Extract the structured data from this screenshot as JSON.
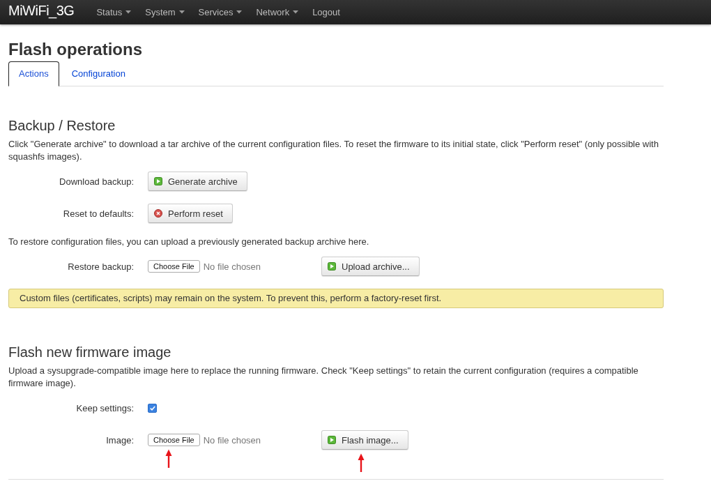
{
  "navbar": {
    "brand": "MiWiFi_3G",
    "menus": [
      {
        "label": "Status",
        "dropdown": true
      },
      {
        "label": "System",
        "dropdown": true
      },
      {
        "label": "Services",
        "dropdown": true
      },
      {
        "label": "Network",
        "dropdown": true
      },
      {
        "label": "Logout",
        "dropdown": false
      }
    ]
  },
  "title": "Flash operations",
  "tabs": [
    {
      "label": "Actions",
      "selected": true
    },
    {
      "label": "Configuration",
      "selected": false
    }
  ],
  "sections": [
    {
      "title": "Backup / Restore",
      "items": [
        {
          "kind": "paragraph",
          "text": "Click \"Generate archive\" to download a tar archive of the current configuration files. To reset the firmware to its initial state, click \"Perform reset\" (only possible with squashfs images)."
        },
        {
          "kind": "field",
          "label": "Download backup:",
          "control": {
            "kind": "button",
            "danger": false,
            "text": "Generate archive"
          }
        },
        {
          "kind": "field",
          "label": "Reset to defaults:",
          "control": {
            "kind": "button",
            "danger": true,
            "text": "Perform reset"
          }
        },
        {
          "kind": "paragraph",
          "text": "To restore configuration files, you can upload a previously generated backup archive here."
        },
        {
          "kind": "field",
          "label": "Restore backup:",
          "control": {
            "kind": "file",
            "button": "Choose File",
            "status": "No file chosen",
            "annotated": false,
            "action": {
              "danger": false,
              "text": "Upload archive...",
              "annotated": false
            }
          }
        },
        {
          "kind": "notice",
          "text": "Custom files (certificates, scripts) may remain on the system. To prevent this, perform a factory-reset first."
        }
      ]
    },
    {
      "title": "Flash new firmware image",
      "items": [
        {
          "kind": "paragraph",
          "text": "Upload a sysupgrade-compatible image here to replace the running firmware. Check \"Keep settings\" to retain the current configuration (requires a compatible firmware image)."
        },
        {
          "kind": "field",
          "label": "Keep settings:",
          "control": {
            "kind": "checkbox",
            "checked": true
          }
        },
        {
          "kind": "field",
          "label": "Image:",
          "control": {
            "kind": "file",
            "button": "Choose File",
            "status": "No file chosen",
            "annotated": true,
            "action": {
              "danger": false,
              "text": "Flash image...",
              "annotated": true
            }
          }
        }
      ]
    }
  ]
}
